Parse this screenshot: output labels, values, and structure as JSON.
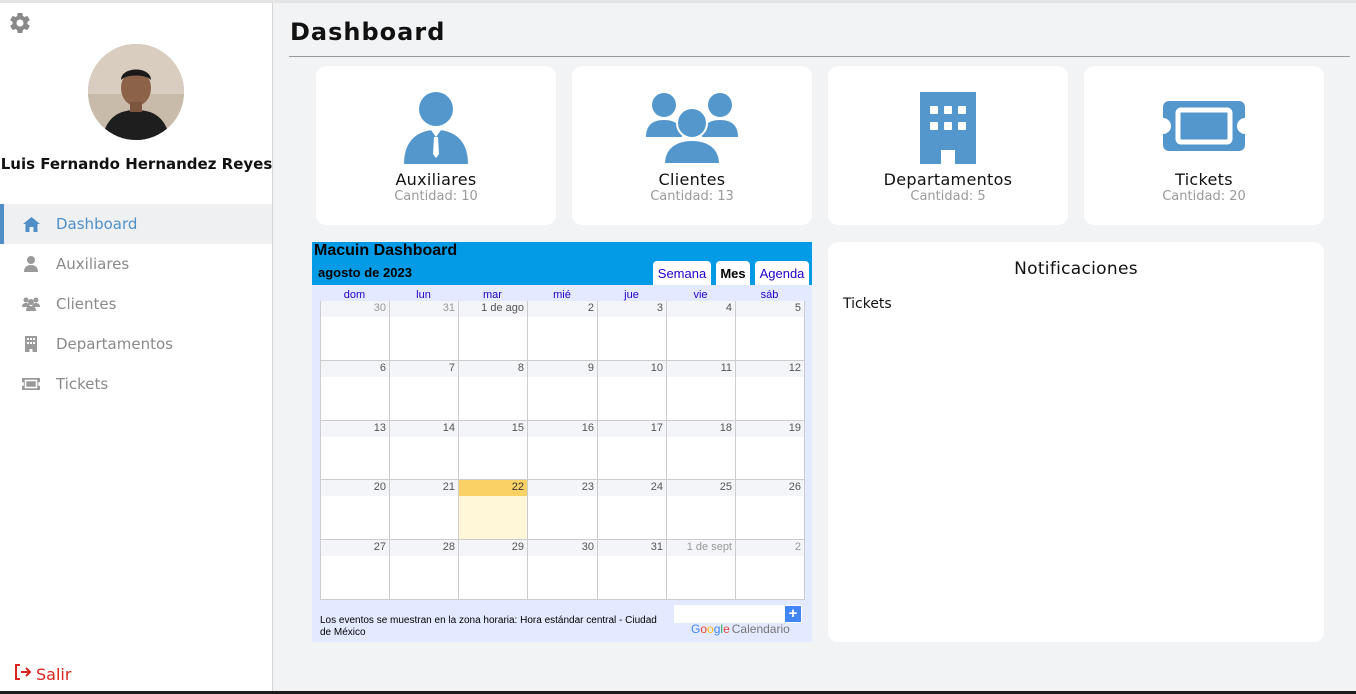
{
  "sidebar": {
    "user_name": "Luis Fernando Hernandez Reyes",
    "items": [
      {
        "label": "Dashboard",
        "icon": "home-icon",
        "active": true
      },
      {
        "label": "Auxiliares",
        "icon": "user-tie-icon",
        "active": false
      },
      {
        "label": "Clientes",
        "icon": "users-icon",
        "active": false
      },
      {
        "label": "Departamentos",
        "icon": "building-icon",
        "active": false
      },
      {
        "label": "Tickets",
        "icon": "ticket-icon",
        "active": false
      }
    ],
    "logout_label": "Salir"
  },
  "header": {
    "title": "Dashboard"
  },
  "cards": [
    {
      "label": "Auxiliares",
      "count": "Cantidad: 10",
      "icon": "user-tie-icon"
    },
    {
      "label": "Clientes",
      "count": "Cantidad: 13",
      "icon": "users-icon"
    },
    {
      "label": "Departamentos",
      "count": "Cantidad: 5",
      "icon": "building-icon"
    },
    {
      "label": "Tickets",
      "count": "Cantidad: 20",
      "icon": "ticket-icon"
    }
  ],
  "calendar": {
    "title": "Macuin Dashboard",
    "month": "agosto de 2023",
    "tabs": [
      {
        "label": "Semana",
        "active": false
      },
      {
        "label": "Mes",
        "active": true
      },
      {
        "label": "Agenda",
        "active": false
      }
    ],
    "weekdays": [
      "dom",
      "lun",
      "mar",
      "mié",
      "jue",
      "vie",
      "sáb"
    ],
    "weeks": [
      [
        {
          "d": "30",
          "o": true
        },
        {
          "d": "31",
          "o": true
        },
        {
          "d": "1 de ago"
        },
        {
          "d": "2"
        },
        {
          "d": "3"
        },
        {
          "d": "4"
        },
        {
          "d": "5"
        }
      ],
      [
        {
          "d": "6"
        },
        {
          "d": "7"
        },
        {
          "d": "8"
        },
        {
          "d": "9"
        },
        {
          "d": "10"
        },
        {
          "d": "11"
        },
        {
          "d": "12"
        }
      ],
      [
        {
          "d": "13"
        },
        {
          "d": "14"
        },
        {
          "d": "15"
        },
        {
          "d": "16"
        },
        {
          "d": "17"
        },
        {
          "d": "18"
        },
        {
          "d": "19"
        }
      ],
      [
        {
          "d": "20"
        },
        {
          "d": "21"
        },
        {
          "d": "22",
          "today": true
        },
        {
          "d": "23"
        },
        {
          "d": "24"
        },
        {
          "d": "25"
        },
        {
          "d": "26"
        }
      ],
      [
        {
          "d": "27"
        },
        {
          "d": "28"
        },
        {
          "d": "29"
        },
        {
          "d": "30"
        },
        {
          "d": "31"
        },
        {
          "d": "1 de sept",
          "o": true
        },
        {
          "d": "2",
          "o": true
        }
      ]
    ],
    "footer_text": "Los eventos se muestran en la zona horaria: Hora estándar central - Ciudad de México",
    "add_label": "+",
    "brand_google": "Google",
    "brand_word": "Calendario"
  },
  "notifications": {
    "title": "Notificaciones",
    "items": [
      "Tickets"
    ]
  },
  "colors": {
    "accent": "#4f8fc6",
    "icon_blue": "#5497cc",
    "calendar_header": "#039be5",
    "today": "#fad165",
    "logout": "#d9251d"
  }
}
